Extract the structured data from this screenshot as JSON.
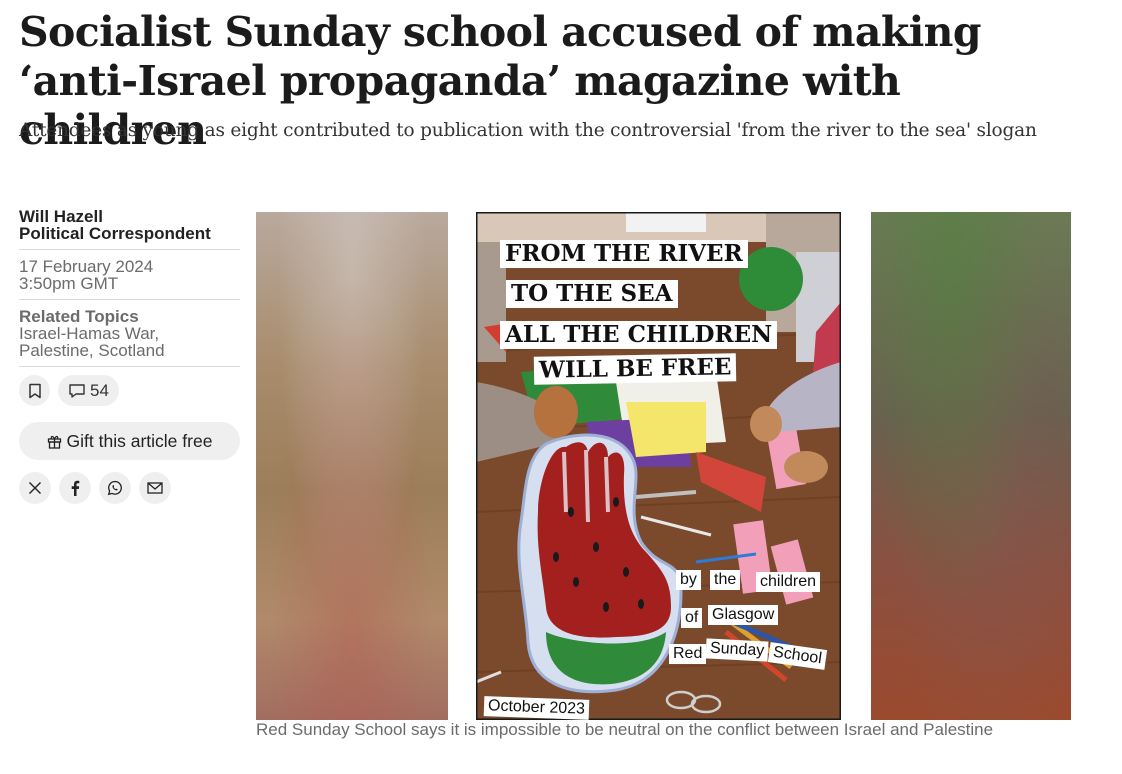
{
  "article": {
    "headline": "Socialist Sunday school accused of making ‘anti-Israel propaganda’ magazine with children",
    "standfirst": "Attendees as young as eight contributed to publication with the controversial 'from the river to the sea' slogan",
    "author": {
      "name": "Will Hazell",
      "role": "Political Correspondent"
    },
    "date": "17 February 2024",
    "time": "3:50pm GMT",
    "related_topics": {
      "heading": "Related Topics",
      "items": [
        "Israel-Hamas War,",
        "Palestine, Scotland"
      ]
    },
    "comment_count": "54",
    "gift_label": "Gift this article free",
    "share_icons": [
      "x-icon",
      "facebook-icon",
      "whatsapp-icon",
      "email-icon"
    ],
    "image": {
      "poster_lines": [
        "FROM THE RIVER",
        "TO THE SEA",
        "ALL THE CHILDREN",
        "WILL BE FREE"
      ],
      "poster_words": [
        "by",
        "the",
        "children",
        "of",
        "Glasgow",
        "Red",
        "Sunday",
        "School"
      ],
      "poster_date": "October 2023"
    },
    "caption": "Red Sunday School says it is impossible to be neutral on the conflict between Israel and Palestine"
  },
  "colors": {
    "text": "#1a1a1a",
    "muted": "#6b6b6b",
    "pill_bg": "#efefef"
  }
}
